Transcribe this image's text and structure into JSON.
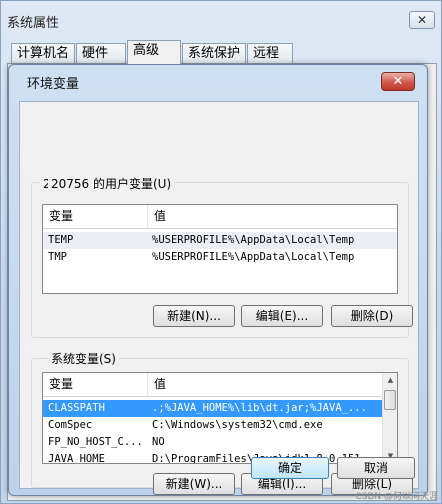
{
  "outer_window": {
    "title": "系统属性",
    "close_glyph": "✕",
    "tabs": [
      {
        "label": "计算机名"
      },
      {
        "label": "硬件"
      },
      {
        "label": "高级"
      },
      {
        "label": "系统保护"
      },
      {
        "label": "远程"
      }
    ],
    "active_tab": "高级"
  },
  "env_dialog": {
    "title": "环境变量",
    "close_glyph": "✕",
    "user_vars": {
      "legend": "20756 的用户变量(U)",
      "columns": [
        "变量",
        "值"
      ],
      "rows": [
        {
          "name": "TEMP",
          "value": "%USERPROFILE%\\AppData\\Local\\Temp"
        },
        {
          "name": "TMP",
          "value": "%USERPROFILE%\\AppData\\Local\\Temp"
        }
      ],
      "buttons": {
        "new": "新建(N)...",
        "edit": "编辑(E)...",
        "delete": "删除(D)"
      }
    },
    "system_vars": {
      "legend": "系统变量(S)",
      "columns": [
        "变量",
        "值"
      ],
      "rows": [
        {
          "name": "CLASSPATH",
          "value": ".;%JAVA_HOME%\\lib\\dt.jar;%JAVA_..."
        },
        {
          "name": "ComSpec",
          "value": "C:\\Windows\\system32\\cmd.exe"
        },
        {
          "name": "FP_NO_HOST_C...",
          "value": "NO"
        },
        {
          "name": "JAVA_HOME",
          "value": "D:\\ProgramFiles\\Java\\jdk1.8.0_151"
        }
      ],
      "selected_row": 0,
      "buttons": {
        "new": "新建(W)...",
        "edit": "编辑(I)...",
        "delete": "删除(L)"
      }
    },
    "ok_label": "确定",
    "cancel_label": "取消"
  },
  "watermark": "CSDN @何以问天涯",
  "colors": {
    "selection": "#3399ff",
    "title_bar": "#c5d9ef",
    "close_button": "#c9483a"
  }
}
